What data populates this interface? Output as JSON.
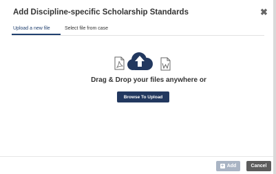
{
  "modal": {
    "title": "Add Discipline-specific Scholarship Standards",
    "close_icon": "close-icon"
  },
  "tabs": [
    {
      "label": "Upload a new file",
      "active": true
    },
    {
      "label": "Select file from case",
      "active": false
    }
  ],
  "dropzone": {
    "icons": [
      "pdf-file-icon",
      "cloud-upload-icon",
      "word-file-icon"
    ],
    "text": "Drag & Drop your files anywhere or",
    "browse_label": "Browse To Upload"
  },
  "footer": {
    "add_label": "Add",
    "add_icon": "plus-icon",
    "cancel_label": "Cancel"
  },
  "colors": {
    "primary": "#22385f",
    "tab_active": "#1f3f6e",
    "add_disabled": "#a9b4c4",
    "cancel": "#5c5c5c"
  }
}
